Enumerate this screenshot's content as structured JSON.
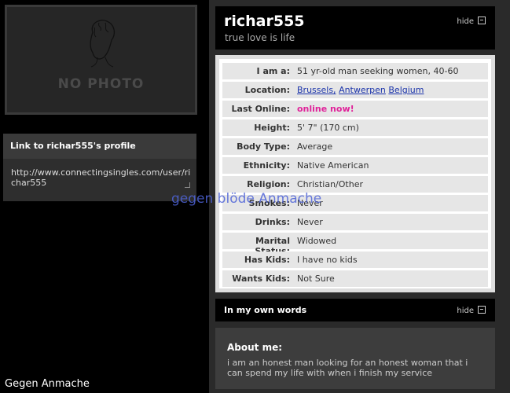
{
  "photo": {
    "placeholder": "NO PHOTO"
  },
  "link_box": {
    "title": "Link to richar555's profile",
    "url": "http://www.connectingsingles.com/user/richar555"
  },
  "profile": {
    "username": "richar555",
    "tagline": "true love is life",
    "hide_label": "hide"
  },
  "details": [
    {
      "label": "I am a:",
      "value": "51 yr-old man seeking women, 40-60"
    },
    {
      "label": "Location:",
      "links": [
        "Brussels,",
        "Antwerpen",
        "Belgium"
      ]
    },
    {
      "label": "Last Online:",
      "value": "online now!"
    },
    {
      "label": "Height:",
      "value": "5' 7\"  (170 cm)"
    },
    {
      "label": "Body Type:",
      "value": "Average"
    },
    {
      "label": "Ethnicity:",
      "value": "Native American"
    },
    {
      "label": "Religion:",
      "value": "Christian/Other"
    },
    {
      "label": "Smokes:",
      "value": "Never"
    },
    {
      "label": "Drinks:",
      "value": "Never"
    },
    {
      "label": "Marital Status:",
      "value": "Widowed"
    },
    {
      "label": "Has Kids:",
      "value": "I have no kids"
    },
    {
      "label": "Wants Kids:",
      "value": "Not Sure"
    }
  ],
  "own_words": {
    "title": "In my own words",
    "hide_label": "hide",
    "about_title": "About me:",
    "about_text": "i am an honest man looking for an honest woman that i can spend my life with when i finish my service"
  },
  "overlay_text": "gegen blöde Anmache",
  "footer_text": "Gegen Anmache",
  "colors": {
    "online": "#e0239a",
    "link": "#1a33aa",
    "overlay": "#4e63d8"
  }
}
